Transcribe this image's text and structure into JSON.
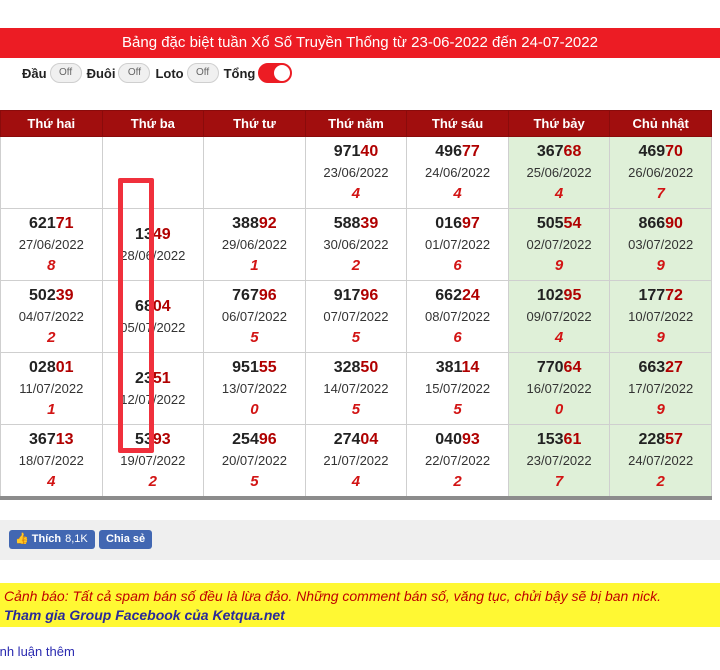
{
  "title": "Bảng đặc biệt tuần Xổ Số Truyền Thống từ 23-06-2022 đến 24-07-2022",
  "toggles": [
    {
      "label": "Đầu",
      "state": "Off"
    },
    {
      "label": "Đuôi",
      "state": "Off"
    },
    {
      "label": "Loto",
      "state": "Off"
    },
    {
      "label": "Tổng",
      "state": ""
    }
  ],
  "headers": [
    "Thứ hai",
    "Thứ ba",
    "Thứ tư",
    "Thứ năm",
    "Thứ sáu",
    "Thứ bảy",
    "Chủ nhật"
  ],
  "rows": [
    [
      {
        "head": "",
        "tail": "",
        "date": "",
        "sum": ""
      },
      {
        "head": "",
        "tail": "",
        "date": "",
        "sum": ""
      },
      {
        "head": "",
        "tail": "",
        "date": "",
        "sum": ""
      },
      {
        "head": "971",
        "tail": "40",
        "date": "23/06/2022",
        "sum": "4"
      },
      {
        "head": "496",
        "tail": "77",
        "date": "24/06/2022",
        "sum": "4"
      },
      {
        "head": "367",
        "tail": "68",
        "date": "25/06/2022",
        "sum": "4"
      },
      {
        "head": "469",
        "tail": "70",
        "date": "26/06/2022",
        "sum": "7"
      }
    ],
    [
      {
        "head": "621",
        "tail": "71",
        "date": "27/06/2022",
        "sum": "8"
      },
      {
        "head": "13",
        "tail": "49",
        "date": "28/06/2022",
        "sum": ""
      },
      {
        "head": "388",
        "tail": "92",
        "date": "29/06/2022",
        "sum": "1"
      },
      {
        "head": "588",
        "tail": "39",
        "date": "30/06/2022",
        "sum": "2"
      },
      {
        "head": "016",
        "tail": "97",
        "date": "01/07/2022",
        "sum": "6"
      },
      {
        "head": "505",
        "tail": "54",
        "date": "02/07/2022",
        "sum": "9"
      },
      {
        "head": "866",
        "tail": "90",
        "date": "03/07/2022",
        "sum": "9"
      }
    ],
    [
      {
        "head": "502",
        "tail": "39",
        "date": "04/07/2022",
        "sum": "2"
      },
      {
        "head": "68",
        "tail": "04",
        "date": "05/07/2022",
        "sum": ""
      },
      {
        "head": "767",
        "tail": "96",
        "date": "06/07/2022",
        "sum": "5"
      },
      {
        "head": "917",
        "tail": "96",
        "date": "07/07/2022",
        "sum": "5"
      },
      {
        "head": "662",
        "tail": "24",
        "date": "08/07/2022",
        "sum": "6"
      },
      {
        "head": "102",
        "tail": "95",
        "date": "09/07/2022",
        "sum": "4"
      },
      {
        "head": "177",
        "tail": "72",
        "date": "10/07/2022",
        "sum": "9"
      }
    ],
    [
      {
        "head": "028",
        "tail": "01",
        "date": "11/07/2022",
        "sum": "1"
      },
      {
        "head": "23",
        "tail": "51",
        "date": "12/07/2022",
        "sum": ""
      },
      {
        "head": "951",
        "tail": "55",
        "date": "13/07/2022",
        "sum": "0"
      },
      {
        "head": "328",
        "tail": "50",
        "date": "14/07/2022",
        "sum": "5"
      },
      {
        "head": "381",
        "tail": "14",
        "date": "15/07/2022",
        "sum": "5"
      },
      {
        "head": "770",
        "tail": "64",
        "date": "16/07/2022",
        "sum": "0"
      },
      {
        "head": "663",
        "tail": "27",
        "date": "17/07/2022",
        "sum": "9"
      }
    ],
    [
      {
        "head": "367",
        "tail": "13",
        "date": "18/07/2022",
        "sum": "4"
      },
      {
        "head": "53",
        "tail": "93",
        "date": "19/07/2022",
        "sum": "2"
      },
      {
        "head": "254",
        "tail": "96",
        "date": "20/07/2022",
        "sum": "5"
      },
      {
        "head": "274",
        "tail": "04",
        "date": "21/07/2022",
        "sum": "4"
      },
      {
        "head": "040",
        "tail": "93",
        "date": "22/07/2022",
        "sum": "2"
      },
      {
        "head": "153",
        "tail": "61",
        "date": "23/07/2022",
        "sum": "7"
      },
      {
        "head": "228",
        "tail": "57",
        "date": "24/07/2022",
        "sum": "2"
      }
    ]
  ],
  "social": {
    "like_label": "Thích",
    "like_count": "8,1K",
    "share_label": "Chia sẻ"
  },
  "warning": {
    "line1": "Cảnh báo: Tất cả spam bán số đều là lừa đảo. Những comment bán số, văng tục, chửi bậy sẽ bị ban nick.",
    "line2": "Tham gia Group Facebook của Ketqua.net"
  },
  "more_link": "ình luận thêm",
  "colors": {
    "accent": "#ec1c24",
    "header_bg": "#a10e0e",
    "weekend_bg": "#dff0d8",
    "highlight": "#f0303c"
  }
}
